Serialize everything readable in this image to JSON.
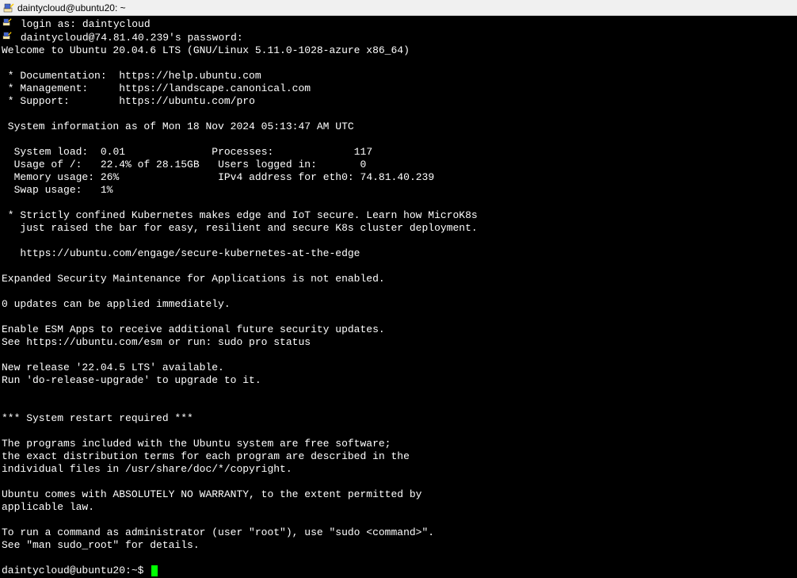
{
  "window": {
    "title": "daintycloud@ubuntu20: ~"
  },
  "login": {
    "login_as_label": "login as:",
    "login_user": "daintycloud",
    "password_prompt": "daintycloud@74.81.40.239's password:"
  },
  "motd": {
    "welcome": "Welcome to Ubuntu 20.04.6 LTS (GNU/Linux 5.11.0-1028-azure x86_64)",
    "doc_label": " * Documentation:",
    "doc_url": "https://help.ubuntu.com",
    "mgmt_label": " * Management:",
    "mgmt_url": "https://landscape.canonical.com",
    "support_label": " * Support:",
    "support_url": "https://ubuntu.com/pro",
    "sysinfo_header": " System information as of Mon 18 Nov 2024 05:13:47 AM UTC",
    "sys_load_label": "System load:",
    "sys_load_value": "0.01",
    "processes_label": "Processes:",
    "processes_value": "117",
    "usage_label": "Usage of /:",
    "usage_value": "22.4% of 28.15GB",
    "users_label": "Users logged in:",
    "users_value": "0",
    "mem_label": "Memory usage:",
    "mem_value": "26%",
    "ipv4_label": "IPv4 address for eth0:",
    "ipv4_value": "74.81.40.239",
    "swap_label": "Swap usage:",
    "swap_value": "1%",
    "k8s_line1": " * Strictly confined Kubernetes makes edge and IoT secure. Learn how MicroK8s",
    "k8s_line2": "   just raised the bar for easy, resilient and secure K8s cluster deployment.",
    "k8s_url": "   https://ubuntu.com/engage/secure-kubernetes-at-the-edge",
    "esm_not_enabled": "Expanded Security Maintenance for Applications is not enabled.",
    "updates": "0 updates can be applied immediately.",
    "esm_enable1": "Enable ESM Apps to receive additional future security updates.",
    "esm_enable2": "See https://ubuntu.com/esm or run: sudo pro status",
    "new_release1": "New release '22.04.5 LTS' available.",
    "new_release2": "Run 'do-release-upgrade' to upgrade to it.",
    "restart": "*** System restart required ***",
    "programs1": "The programs included with the Ubuntu system are free software;",
    "programs2": "the exact distribution terms for each program are described in the",
    "programs3": "individual files in /usr/share/doc/*/copyright.",
    "warranty1": "Ubuntu comes with ABSOLUTELY NO WARRANTY, to the extent permitted by",
    "warranty2": "applicable law.",
    "sudo1": "To run a command as administrator (user \"root\"), use \"sudo <command>\".",
    "sudo2": "See \"man sudo_root\" for details."
  },
  "prompt": {
    "text": "daintycloud@ubuntu20:~$"
  }
}
